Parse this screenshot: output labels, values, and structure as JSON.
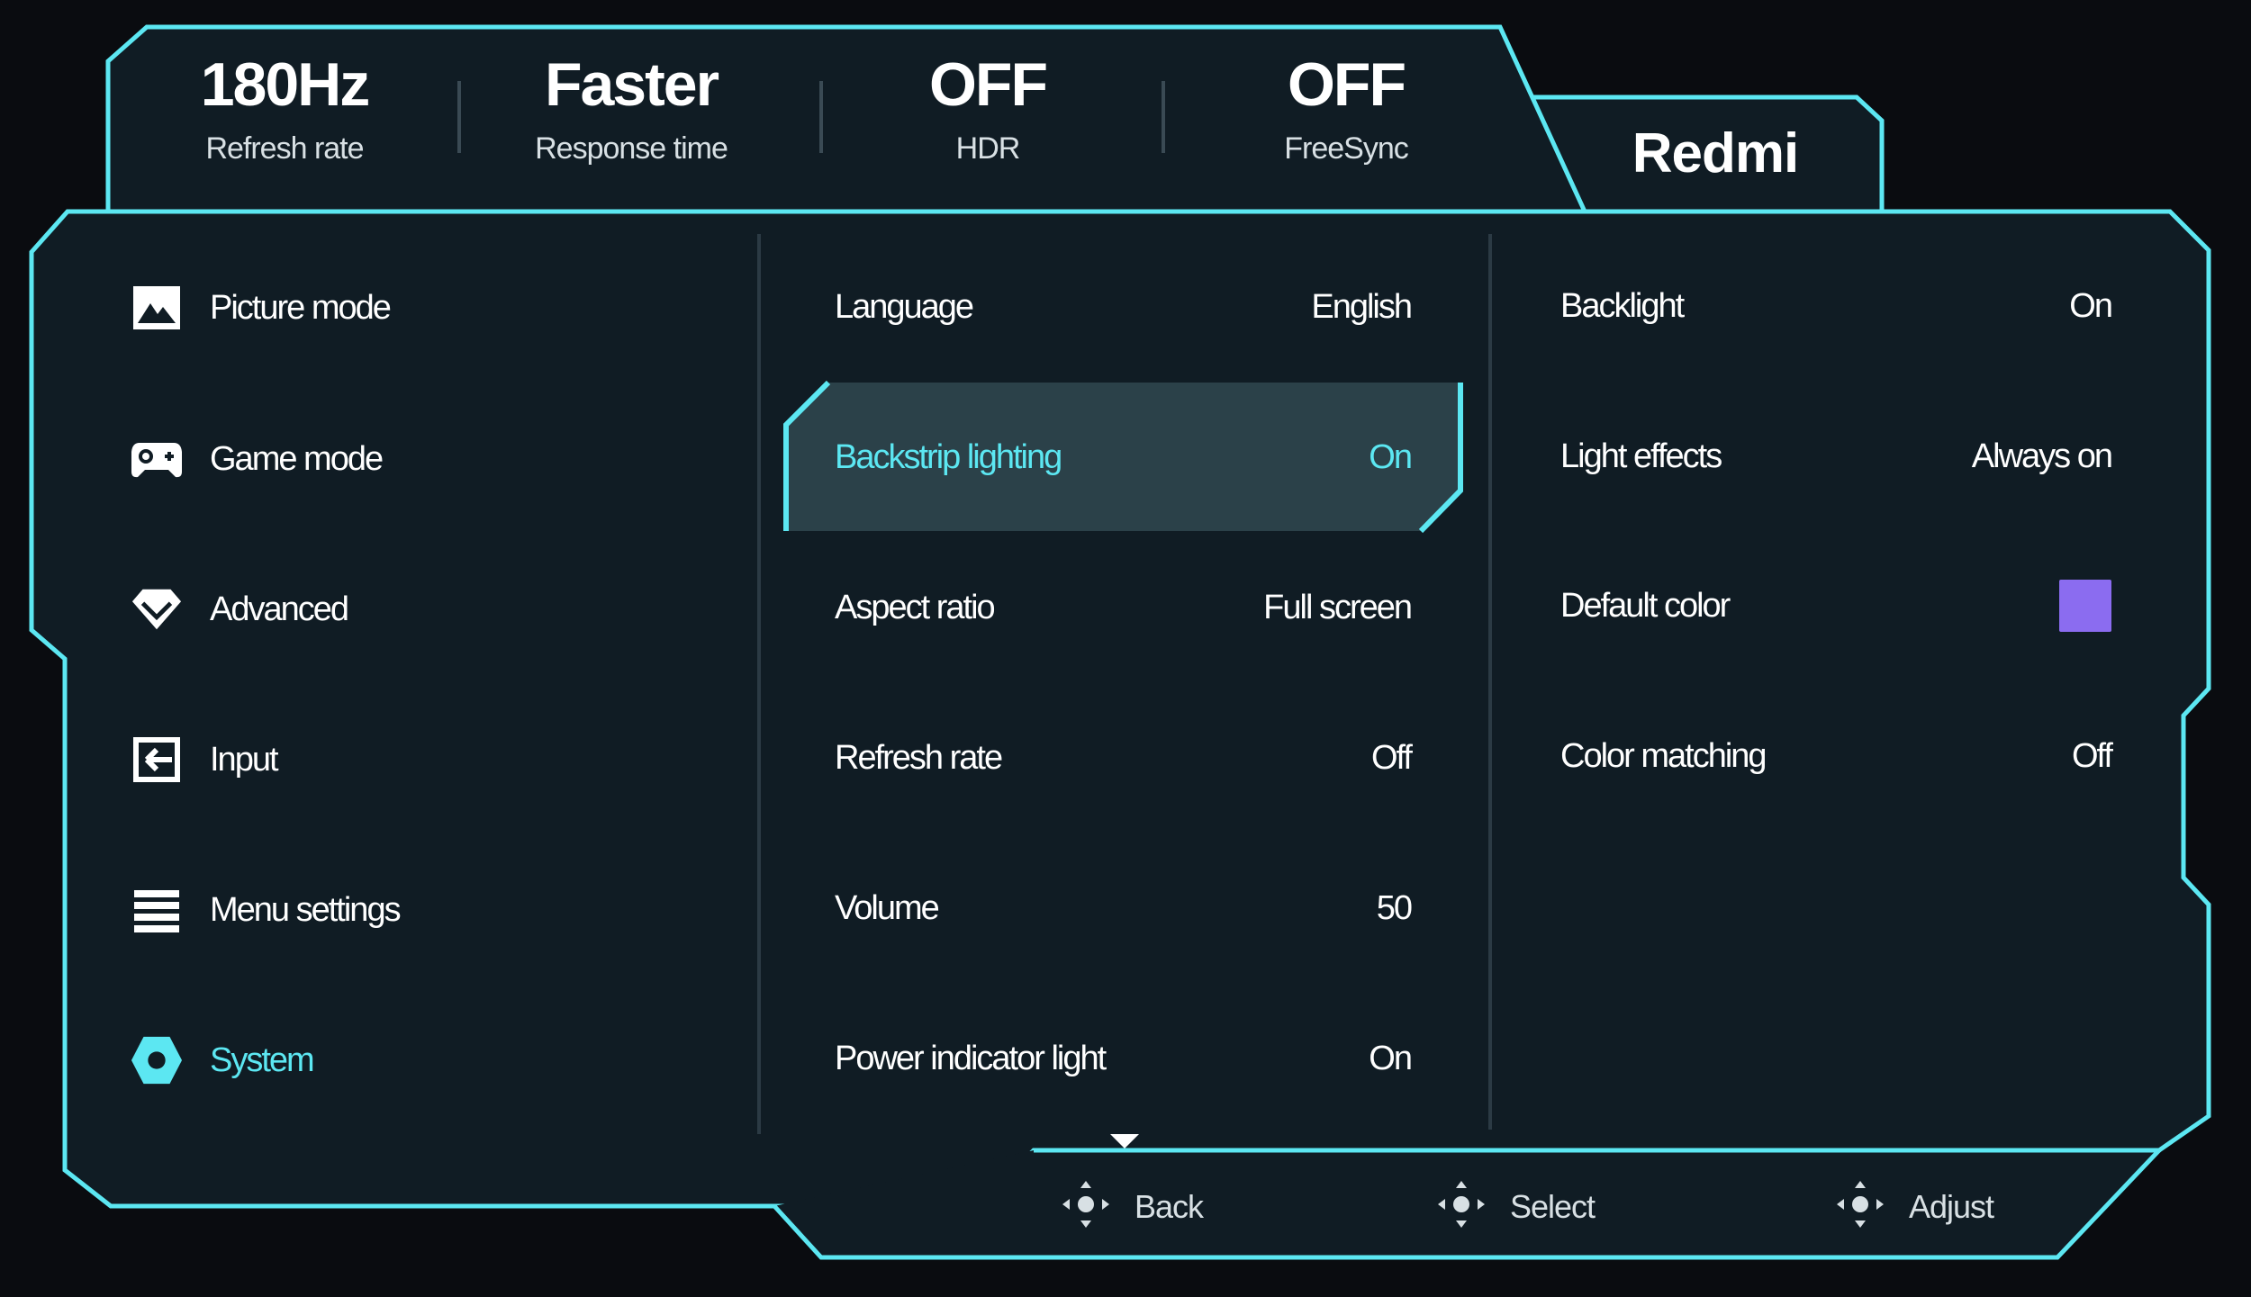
{
  "status_bar": [
    {
      "value": "180Hz",
      "label": "Refresh rate"
    },
    {
      "value": "Faster",
      "label": "Response time"
    },
    {
      "value": "OFF",
      "label": "HDR"
    },
    {
      "value": "OFF",
      "label": "FreeSync"
    }
  ],
  "brand": "Redmi",
  "colors": {
    "accent": "#5ce7f2",
    "panel": "#101c24",
    "default_color_swatch": "#8b6cf0"
  },
  "categories": [
    {
      "label": "Picture mode",
      "icon": "picture-icon"
    },
    {
      "label": "Game mode",
      "icon": "gamepad-icon"
    },
    {
      "label": "Advanced",
      "icon": "diamond-icon"
    },
    {
      "label": "Input",
      "icon": "input-icon"
    },
    {
      "label": "Menu settings",
      "icon": "menu-icon"
    },
    {
      "label": "System",
      "icon": "gear-icon",
      "active": true
    }
  ],
  "settings": [
    {
      "label": "Language",
      "value": "English"
    },
    {
      "label": "Backstrip lighting",
      "value": "On",
      "selected": true
    },
    {
      "label": "Aspect ratio",
      "value": "Full screen"
    },
    {
      "label": "Refresh rate",
      "value": "Off"
    },
    {
      "label": "Volume",
      "value": "50"
    },
    {
      "label": "Power indicator light",
      "value": "On"
    }
  ],
  "submenu": [
    {
      "label": "Backlight",
      "value": "On"
    },
    {
      "label": "Light effects",
      "value": "Always on"
    },
    {
      "label": "Default color",
      "value": ""
    },
    {
      "label": "Color matching",
      "value": "Off"
    }
  ],
  "scroll_indicator": "chevron-down-icon",
  "hints": [
    {
      "label": "Back",
      "icon": "dpad-icon"
    },
    {
      "label": "Select",
      "icon": "dpad-icon"
    },
    {
      "label": "Adjust",
      "icon": "dpad-icon"
    }
  ]
}
